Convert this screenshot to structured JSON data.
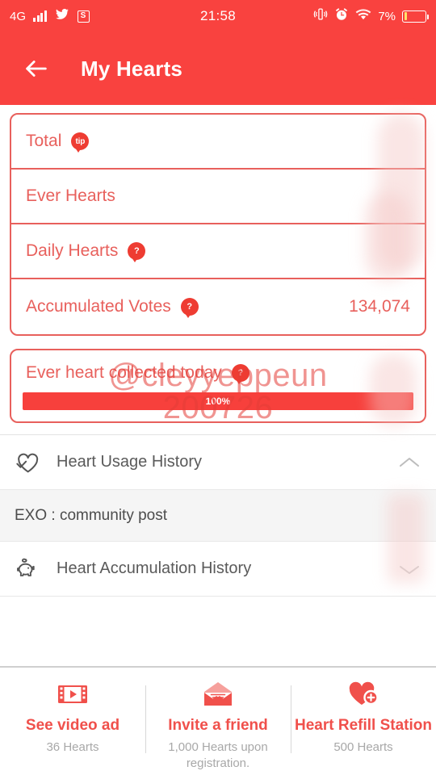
{
  "status_bar": {
    "network": "4G",
    "signal_icon": "signal-bars-icon",
    "twitter_icon": "twitter-icon",
    "app_icon": "s-app-icon",
    "time": "21:58",
    "vibrate_icon": "vibrate-icon",
    "alarm_icon": "alarm-clock-icon",
    "wifi_icon": "wifi-icon",
    "battery_percent": "7%",
    "battery_icon": "battery-icon"
  },
  "app_bar": {
    "back_icon": "back-arrow-icon",
    "title": "My Hearts"
  },
  "hearts_card": {
    "rows": [
      {
        "label": "Total",
        "badge": "tip",
        "badge_name": "tip-badge-icon",
        "value": ""
      },
      {
        "label": "Ever Hearts",
        "badge": "",
        "badge_name": "",
        "value": ""
      },
      {
        "label": "Daily Hearts",
        "badge": "?",
        "badge_name": "help-badge-icon",
        "value": ""
      },
      {
        "label": "Accumulated Votes",
        "badge": "?",
        "badge_name": "help-badge-icon",
        "value": "134,074"
      }
    ]
  },
  "progress_card": {
    "label": "Ever heart collected today",
    "badge": "?",
    "value": "",
    "percent_text": "100%",
    "percent": 100
  },
  "history": {
    "usage": {
      "icon": "heart-check-icon",
      "label": "Heart Usage History",
      "chevron": "chevron-up-icon",
      "expanded": true,
      "entries": [
        {
          "label": "EXO : community post",
          "value": ""
        }
      ]
    },
    "accumulation": {
      "icon": "piggy-bank-icon",
      "label": "Heart Accumulation History",
      "chevron": "chevron-down-icon",
      "expanded": false
    }
  },
  "bottom_actions": [
    {
      "icon": "video-ad-icon",
      "title": "See video ad",
      "subtitle": "36 Hearts"
    },
    {
      "icon": "envelope-icon",
      "title": "Invite a friend",
      "subtitle": "1,000 Hearts upon registration."
    },
    {
      "icon": "heart-plus-icon",
      "title": "Heart Refill Station",
      "subtitle": "500 Hearts"
    }
  ],
  "watermark": {
    "line1": "@cleyyeppeun",
    "line2": "200726"
  },
  "colors": {
    "brand_red": "#F9423F",
    "card_border": "#E8605C",
    "badge_red": "#EE3C32",
    "progress_fill": "#F7403C",
    "muted_text": "#A8A8A8"
  }
}
